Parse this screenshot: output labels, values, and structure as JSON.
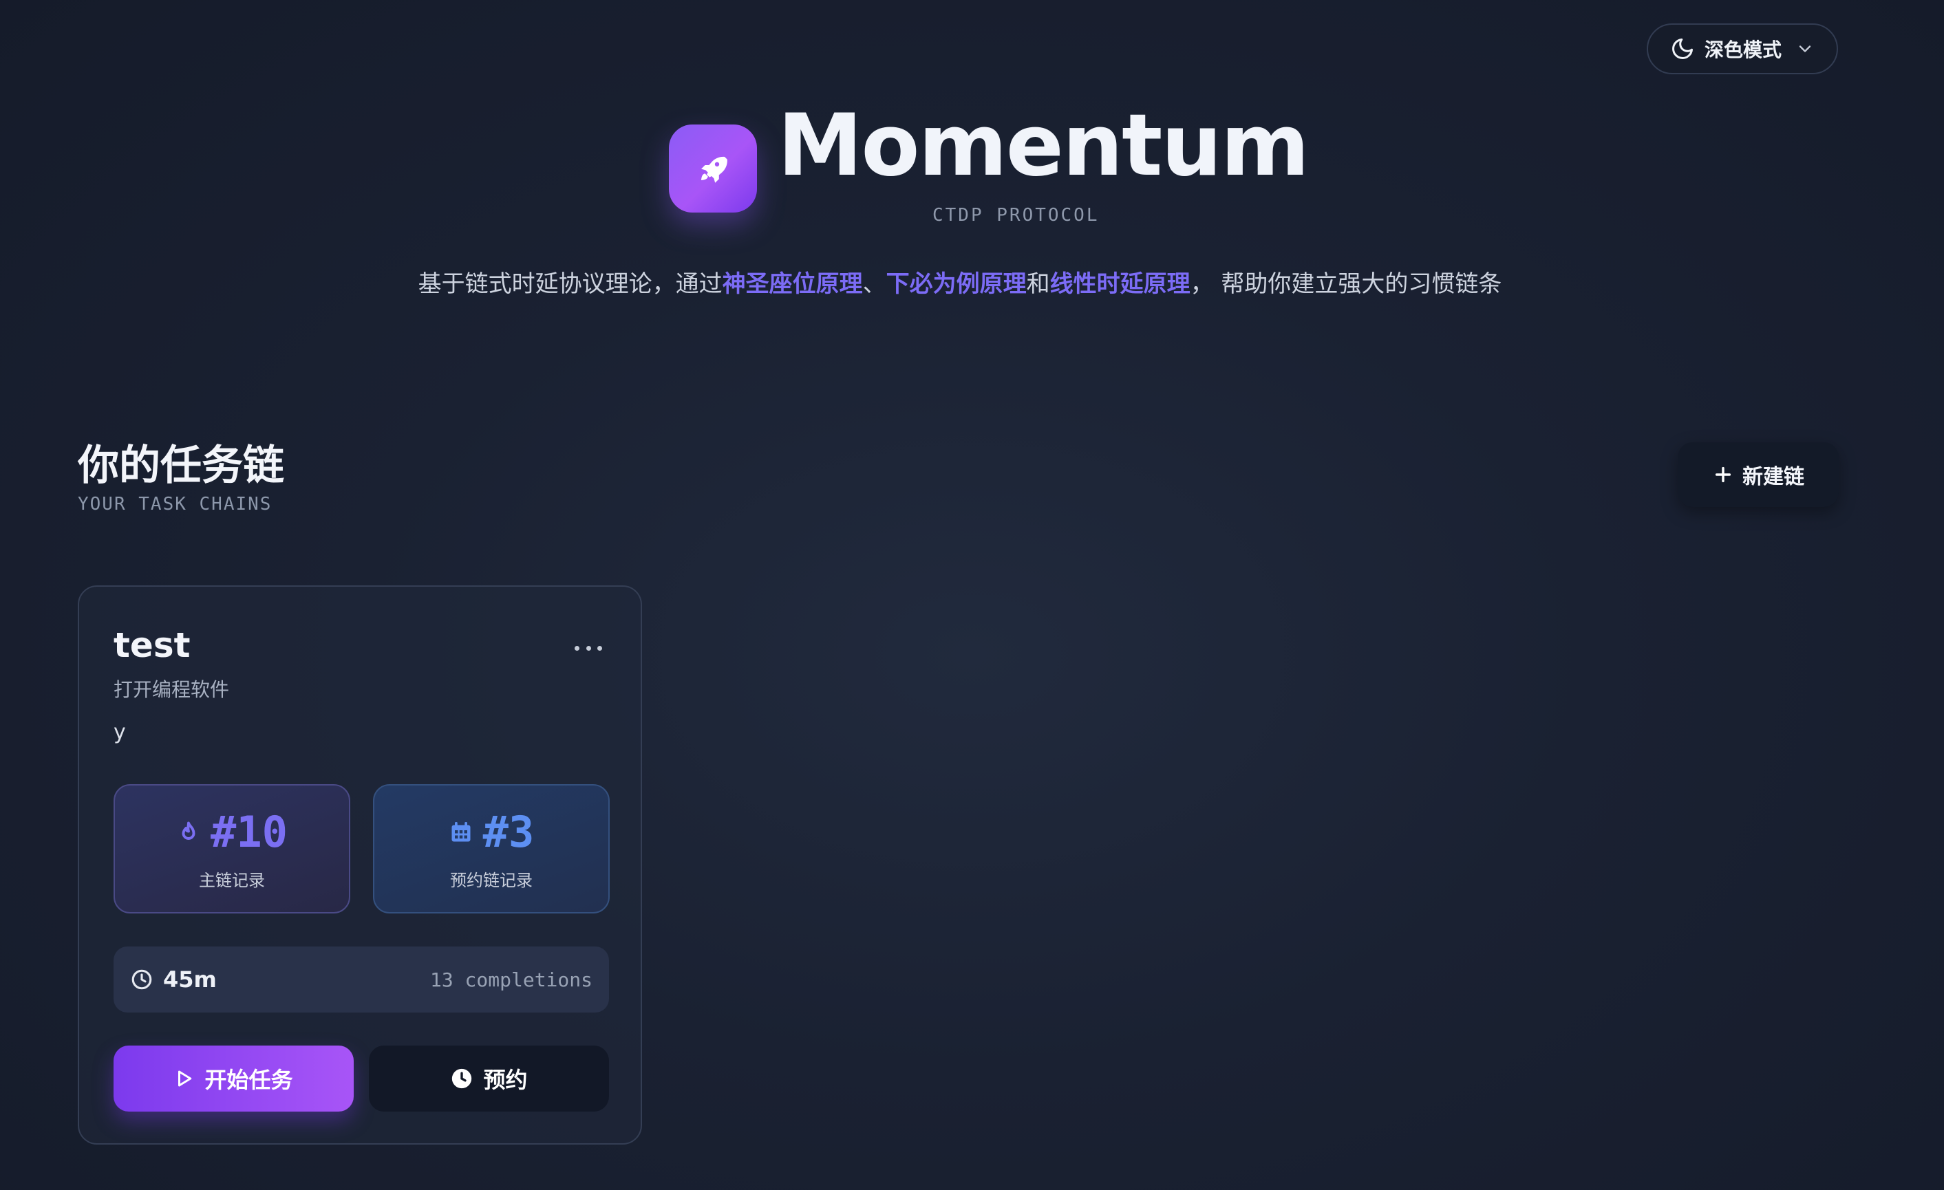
{
  "header": {
    "theme_label": "深色模式",
    "app_title": "Momentum",
    "app_subtitle": "CTDP PROTOCOL",
    "tagline": {
      "part1": "基于链式时延协议理论，通过",
      "highlight1": "神圣座位原理",
      "sep1": "、",
      "highlight2": "下必为例原理",
      "sep2": "和",
      "highlight3": "线性时延原理",
      "part2": "， 帮助你建立强大的习惯链条"
    },
    "accent_color": "#8b5cf6",
    "highlight_color": "#7c6cf6"
  },
  "section": {
    "title": "你的任务链",
    "subtitle": "YOUR TASK CHAINS",
    "new_chain_label": "新建链"
  },
  "chains": [
    {
      "name": "test",
      "trigger": "打开编程软件",
      "description": "y",
      "main_record": "#10",
      "main_record_label": "主链记录",
      "schedule_record": "#3",
      "schedule_record_label": "预约链记录",
      "duration": "45m",
      "completions": "13 completions",
      "start_label": "开始任务",
      "schedule_label": "预约"
    }
  ],
  "icons": {
    "theme": "moon-icon",
    "dropdown": "chevron-down-icon",
    "logo": "rocket-icon",
    "add": "plus-icon",
    "more": "more-horizontal-icon",
    "main_record": "flame-icon",
    "schedule_record": "calendar-icon",
    "duration": "clock-icon",
    "start": "play-icon",
    "schedule": "clock-filled-icon"
  }
}
